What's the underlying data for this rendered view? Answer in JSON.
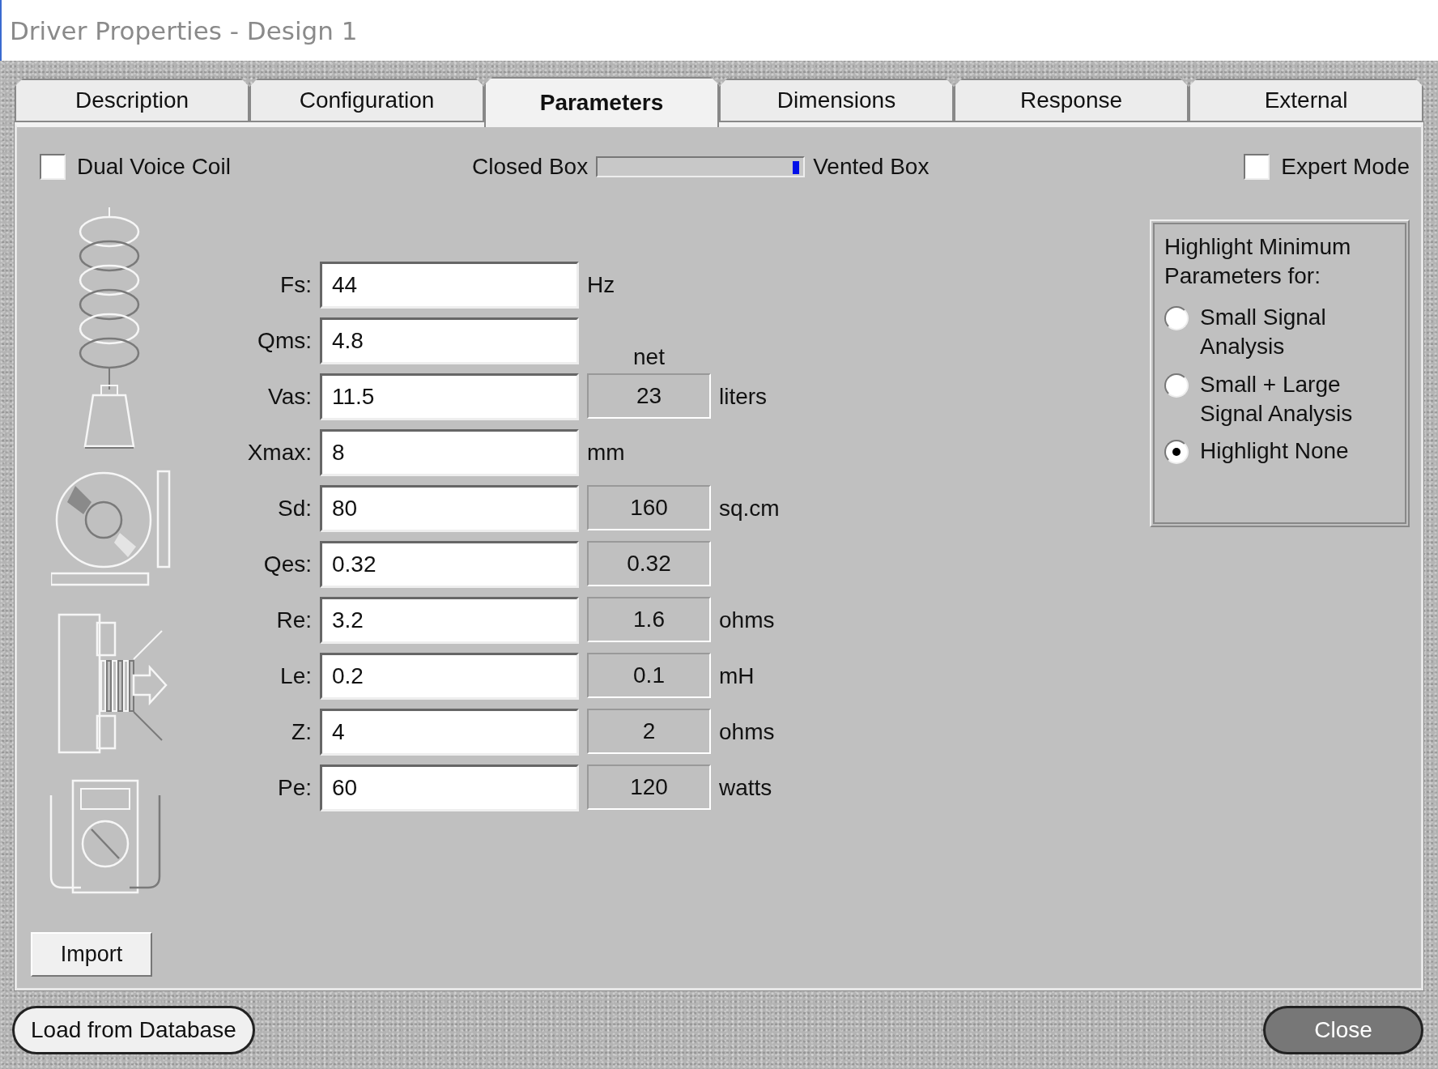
{
  "window": {
    "title": "Driver Properties - Design 1"
  },
  "tabs": [
    {
      "label": "Description",
      "selected": false
    },
    {
      "label": "Configuration",
      "selected": false
    },
    {
      "label": "Parameters",
      "selected": true
    },
    {
      "label": "Dimensions",
      "selected": false
    },
    {
      "label": "Response",
      "selected": false
    },
    {
      "label": "External",
      "selected": false
    }
  ],
  "dual_voice_coil": {
    "label": "Dual Voice Coil",
    "checked": false
  },
  "box_slider": {
    "left_label": "Closed Box",
    "right_label": "Vented Box",
    "level": 0.98
  },
  "expert_mode": {
    "label": "Expert Mode",
    "checked": false
  },
  "parameters": [
    {
      "label": "Fs:",
      "value": "44",
      "unit": "Hz"
    },
    {
      "label": "Qms:",
      "value": "4.8"
    },
    {
      "label": "Vas:",
      "value": "11.5",
      "secondary_heading": "net",
      "secondary": "23",
      "unit": "liters"
    },
    {
      "label": "Xmax:",
      "value": "8",
      "unit": "mm"
    },
    {
      "label": "Sd:",
      "value": "80",
      "secondary": "160",
      "unit": "sq.cm"
    },
    {
      "label": "Qes:",
      "value": "0.32",
      "secondary": "0.32"
    },
    {
      "label": "Re:",
      "value": "3.2",
      "secondary": "1.6",
      "unit": "ohms"
    },
    {
      "label": "Le:",
      "value": "0.2",
      "secondary": "0.1",
      "unit": "mH"
    },
    {
      "label": "Z:",
      "value": "4",
      "secondary": "2",
      "unit": "ohms"
    },
    {
      "label": "Pe:",
      "value": "60",
      "secondary": "120",
      "unit": "watts"
    }
  ],
  "highlight_group": {
    "title": "Highlight Minimum Parameters for:",
    "options": [
      {
        "label": "Small Signal Analysis",
        "selected": false
      },
      {
        "label": "Small + Large Signal Analysis",
        "selected": false
      },
      {
        "label": "Highlight None",
        "selected": true
      }
    ]
  },
  "import_button": "Import",
  "load_button": "Load from Database",
  "close_button": "Close"
}
